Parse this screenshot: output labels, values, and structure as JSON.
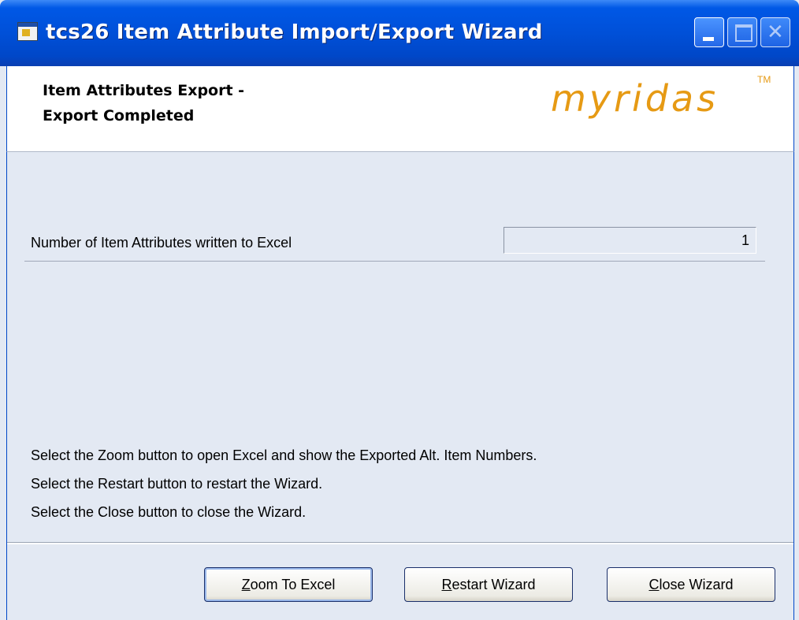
{
  "window": {
    "title": "tcs26 Item Attribute Import/Export Wizard"
  },
  "header": {
    "line1": "Item Attributes Export -",
    "line2": "Export Completed",
    "logo": "myridas",
    "logo_tm": "TM"
  },
  "field": {
    "label": "Number of Item Attributes written to Excel",
    "value": "1"
  },
  "messages": [
    "Select the Zoom button to open Excel and show the Exported Alt. Item Numbers.",
    "Select the Restart button to restart the Wizard.",
    "Select the Close button to close the Wizard."
  ],
  "buttons": {
    "zoom": {
      "mnemonic": "Z",
      "rest": "oom To Excel"
    },
    "restart": {
      "mnemonic": "R",
      "rest": "estart Wizard"
    },
    "close": {
      "mnemonic": "C",
      "rest": "lose Wizard"
    }
  },
  "colors": {
    "titlebar": "#0050d8",
    "body": "#e3e9f3",
    "logo": "#e69a14"
  }
}
